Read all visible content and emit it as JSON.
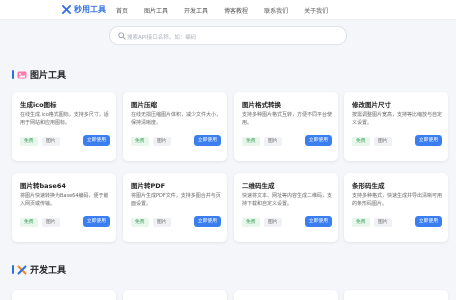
{
  "header": {
    "brand": "秒用工具",
    "nav": [
      "首页",
      "图片工具",
      "开发工具",
      "博客教程",
      "联系我们",
      "关于我们"
    ]
  },
  "search": {
    "placeholder": "搜索API接口名称，如：编码"
  },
  "sections": [
    {
      "title": "图片工具",
      "cards": [
        {
          "title": "生成ico图标",
          "desc": "在线生成.ico格式图标，支持多尺寸，适用于网站和应用图标。",
          "tag_free": "免费",
          "tag_cat": "图片",
          "button": "立即使用"
        },
        {
          "title": "图片压缩",
          "desc": "在线无损压缩图片体积，减少文件大小，保持清晰度。",
          "tag_free": "免费",
          "tag_cat": "图片",
          "button": "立即使用"
        },
        {
          "title": "图片格式转换",
          "desc": "支持多种图片格式互转，方便不同平台使用。",
          "tag_free": "免费",
          "tag_cat": "图片",
          "button": "立即使用"
        },
        {
          "title": "修改图片尺寸",
          "desc": "按需调整图片宽高，支持等比缩放与自定义设置。",
          "tag_free": "免费",
          "tag_cat": "图片",
          "button": "立即使用"
        },
        {
          "title": "图片转base64",
          "desc": "将图片快速转换为Base64编码，便于嵌入网页或传输。",
          "tag_free": "免费",
          "tag_cat": "图片",
          "button": "立即使用"
        },
        {
          "title": "图片转PDF",
          "desc": "将图片生成PDF文件，支持多图合并与页面设置。",
          "tag_free": "免费",
          "tag_cat": "图片",
          "button": "立即使用"
        },
        {
          "title": "二维码生成",
          "desc": "快速将文本、网址等内容生成二维码，支持下载和自定义设置。",
          "tag_free": "免费",
          "tag_cat": "图片",
          "button": "立即使用"
        },
        {
          "title": "条形码生成",
          "desc": "支持多种格式，快速生成并导出清晰可用的条形码图片。",
          "tag_free": "免费",
          "tag_cat": "图片",
          "button": "立即使用"
        }
      ]
    },
    {
      "title": "开发工具"
    }
  ],
  "colors": {
    "accent": "#2f6fe4",
    "button": "#3b7ef0",
    "free_tag": "#3da35d"
  }
}
